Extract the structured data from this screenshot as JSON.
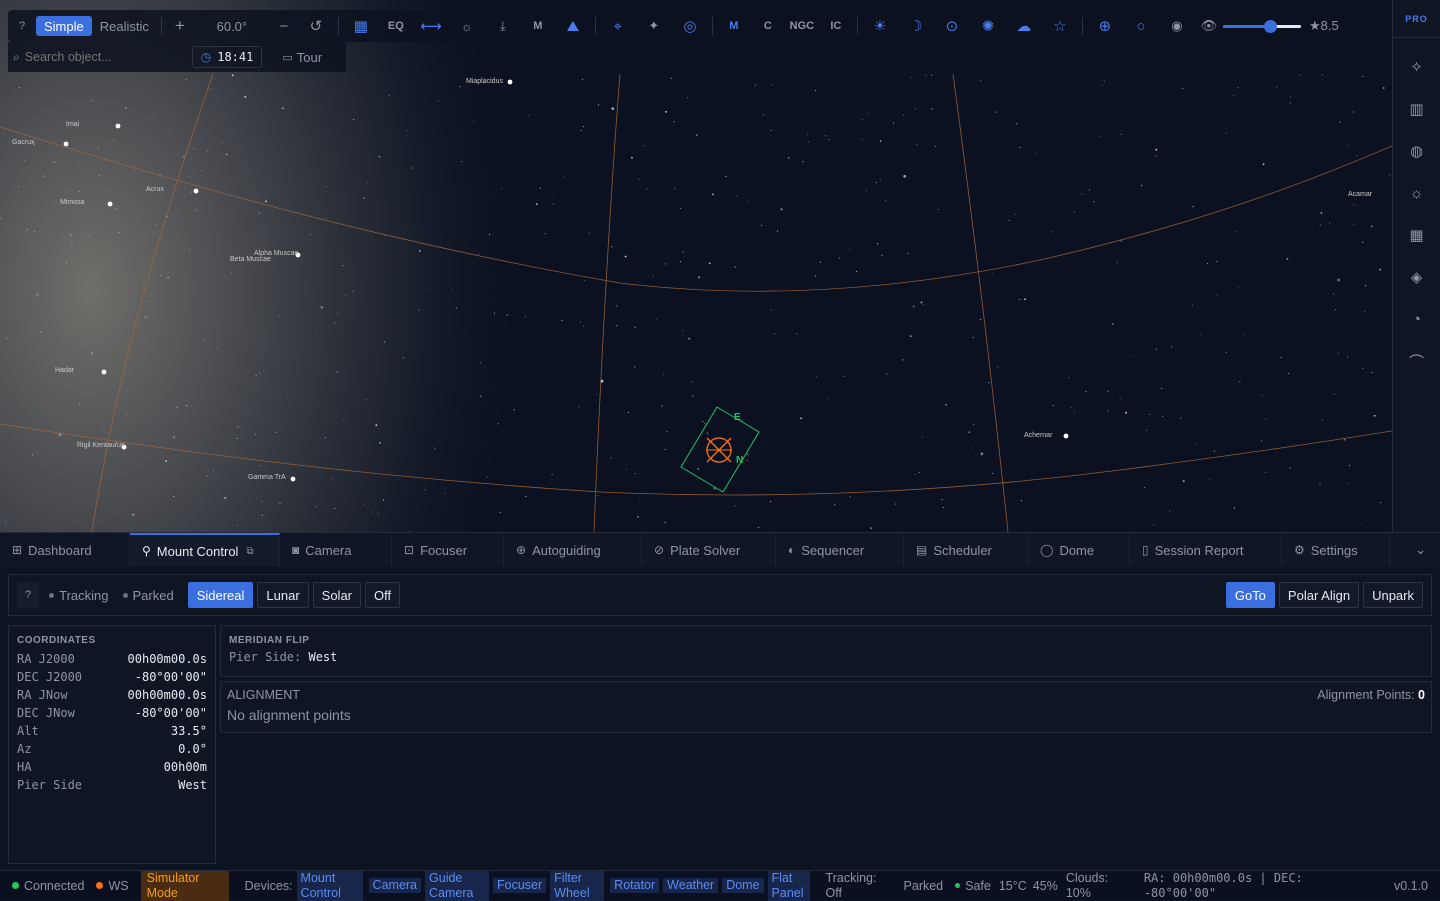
{
  "toolbar": {
    "help": "?",
    "mode_simple": "Simple",
    "mode_realistic": "Realistic",
    "zoom_in": "+",
    "fov": "60.0°",
    "zoom_out": "−",
    "eq_label": "EQ",
    "m_label": "M",
    "catalog_m": "M",
    "catalog_c": "C",
    "catalog_ngc": "NGC",
    "catalog_ic": "IC",
    "magnitude": "★8.5",
    "magnitude_slider_value": 0.6,
    "search_placeholder": "Search object...",
    "time": "18:41",
    "tour": "Tour"
  },
  "sidebar": {
    "pro": "PRO"
  },
  "sky": {
    "stars": [
      {
        "name": "Miaplacidus"
      },
      {
        "name": "Imai"
      },
      {
        "name": "Gacrux"
      },
      {
        "name": "Acrux"
      },
      {
        "name": "Mimosa"
      },
      {
        "name": "Alpha Muscae"
      },
      {
        "name": "Beta Muscae"
      },
      {
        "name": "Hadar"
      },
      {
        "name": "Rigil Kentaurus"
      },
      {
        "name": "Gamma TrA"
      },
      {
        "name": "Acamar"
      },
      {
        "name": "Achernar"
      }
    ],
    "reticle_e": "E",
    "reticle_n": "N"
  },
  "tabs": [
    {
      "label": "Dashboard"
    },
    {
      "label": "Mount Control"
    },
    {
      "label": "Camera"
    },
    {
      "label": "Focuser"
    },
    {
      "label": "Autoguiding"
    },
    {
      "label": "Plate Solver"
    },
    {
      "label": "Sequencer"
    },
    {
      "label": "Scheduler"
    },
    {
      "label": "Dome"
    },
    {
      "label": "Session Report"
    },
    {
      "label": "Settings"
    }
  ],
  "control": {
    "help": "?",
    "tracking": "Tracking",
    "parked": "Parked",
    "rates": [
      "Sidereal",
      "Lunar",
      "Solar",
      "Off"
    ],
    "goto": "GoTo",
    "polar_align": "Polar Align",
    "unpark": "Unpark"
  },
  "coordinates": {
    "title": "COORDINATES",
    "rows": [
      {
        "k": "RA J2000",
        "v": "00h00m00.0s"
      },
      {
        "k": "DEC J2000",
        "v": "-80°00'00\""
      },
      {
        "k": "RA JNow",
        "v": "00h00m00.0s"
      },
      {
        "k": "DEC JNow",
        "v": "-80°00'00\""
      },
      {
        "k": "Alt",
        "v": "33.5°"
      },
      {
        "k": "Az",
        "v": "0.0°"
      },
      {
        "k": "HA",
        "v": "00h00m"
      },
      {
        "k": "Pier Side",
        "v": "West"
      }
    ]
  },
  "meridian": {
    "title": "MERIDIAN FLIP",
    "pier_label": "Pier Side:",
    "pier_value": "West"
  },
  "alignment": {
    "title": "ALIGNMENT",
    "points_label": "Alignment Points:",
    "points_value": "0",
    "empty": "No alignment points"
  },
  "statusbar": {
    "connected": "Connected",
    "ws": "WS",
    "simulator": "Simulator Mode",
    "devices_label": "Devices:",
    "devices": [
      "Mount Control",
      "Camera",
      "Guide Camera",
      "Focuser",
      "Filter Wheel",
      "Rotator",
      "Weather",
      "Dome",
      "Flat Panel"
    ],
    "tracking": "Tracking: Off",
    "parked": "Parked",
    "safe": "Safe",
    "temp": "15°C",
    "humidity": "45%",
    "clouds": "Clouds: 10%",
    "radec": "RA: 00h00m00.0s | DEC: -80°00'00\"",
    "version": "v0.1.0"
  },
  "colors": {
    "accent": "#3b6fe0",
    "reticle": "#22c55e",
    "crosshair": "#f97316",
    "grid": "#b0733d"
  }
}
